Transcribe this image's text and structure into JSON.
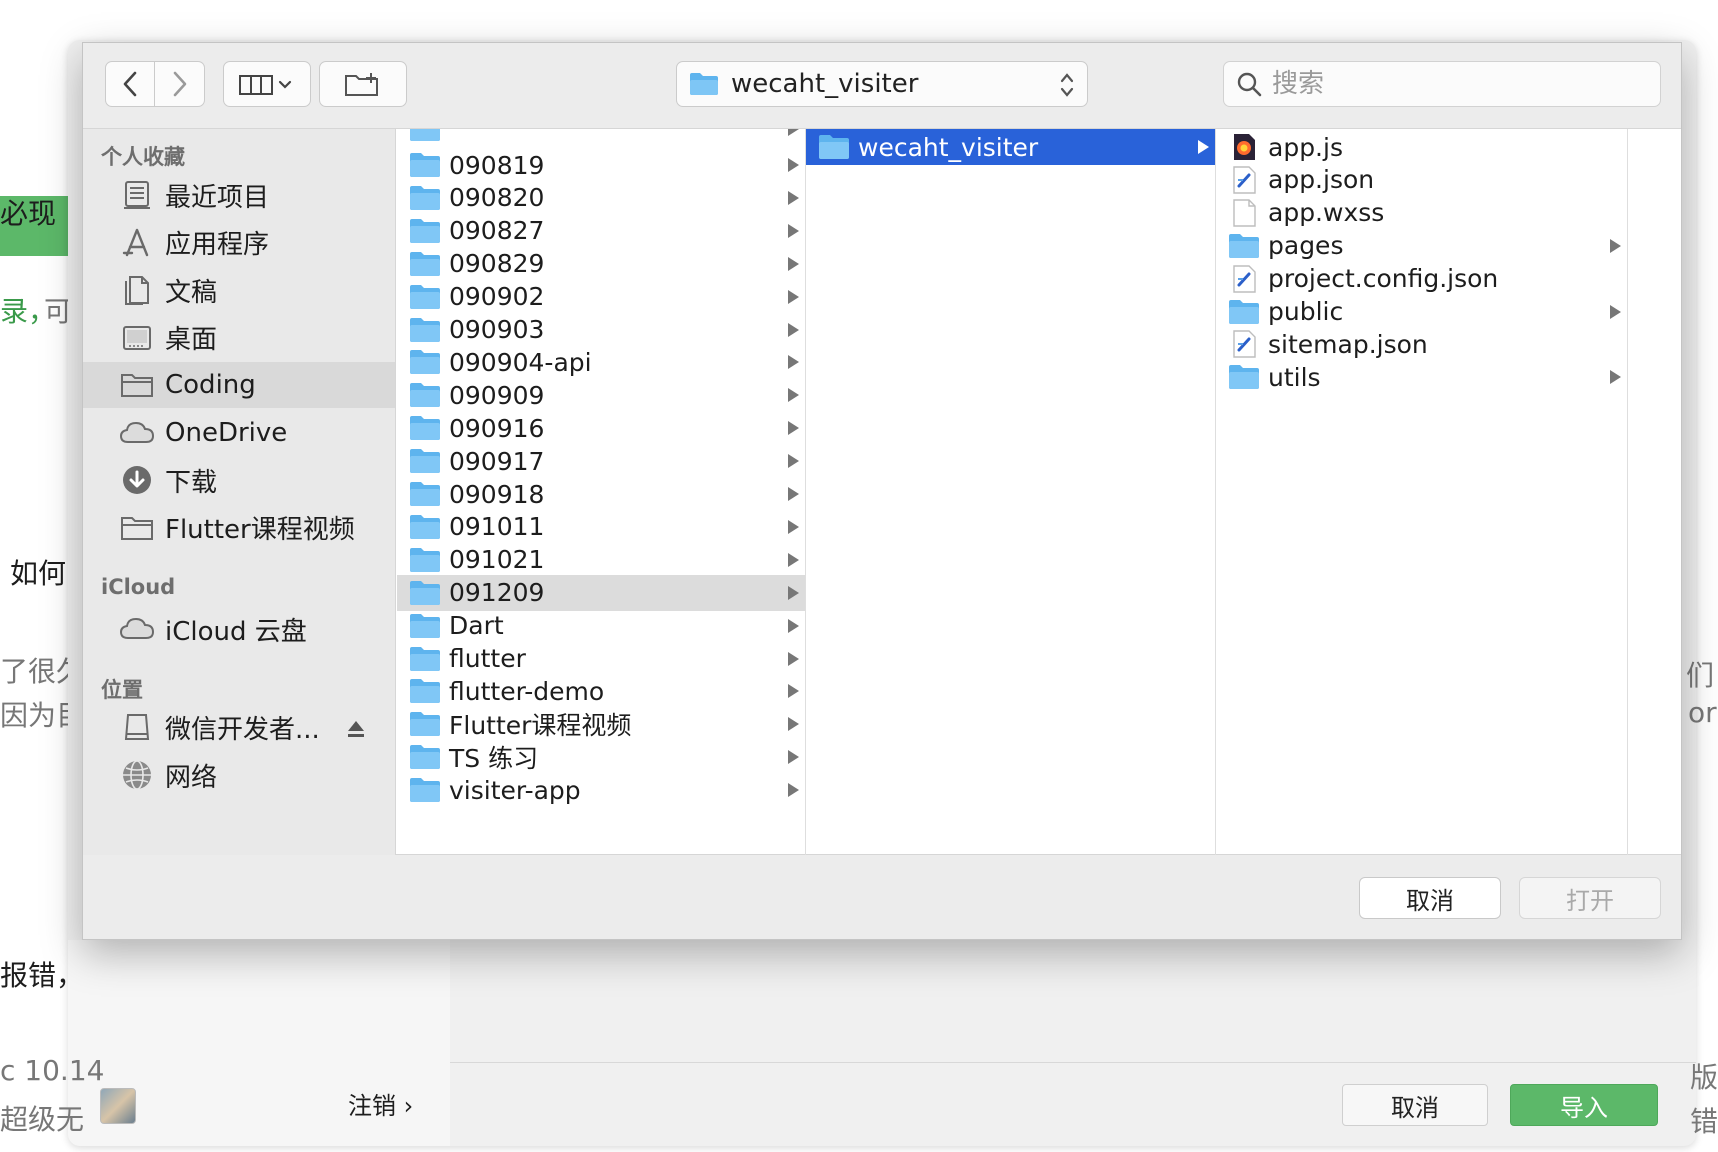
{
  "background": {
    "fragments": [
      "必现",
      "录，",
      "可",
      "如何",
      "了很久",
      "因为目",
      "报错，",
      "c 10.14",
      "超级无",
      "们",
      "or",
      "版",
      "错"
    ],
    "accent_color": "#5cb869",
    "logout_label": "注销",
    "logout_chevron": "›",
    "cancel_label": "取消",
    "import_label": "导入"
  },
  "dialog": {
    "toolbar": {
      "back_icon": "chevron-left-icon",
      "forward_icon": "chevron-right-icon",
      "view_icon": "column-view-icon",
      "new_folder_icon": "new-folder-icon",
      "path_label": "wecaht_visiter",
      "search_placeholder": "搜索"
    },
    "sidebar": {
      "sections": [
        {
          "title": "个人收藏"
        },
        {
          "title": "iCloud"
        },
        {
          "title": "位置"
        }
      ],
      "favorites": [
        {
          "label": "最近项目",
          "icon": "recents-icon"
        },
        {
          "label": "应用程序",
          "icon": "applications-icon"
        },
        {
          "label": "文稿",
          "icon": "documents-icon"
        },
        {
          "label": "桌面",
          "icon": "desktop-icon"
        },
        {
          "label": "Coding",
          "icon": "folder-icon",
          "selected": true
        },
        {
          "label": "OneDrive",
          "icon": "cloud-icon"
        },
        {
          "label": "下载",
          "icon": "download-icon"
        },
        {
          "label": "Flutter课程视频",
          "icon": "folder-icon"
        }
      ],
      "icloud": [
        {
          "label": "iCloud 云盘",
          "icon": "cloud-icon"
        }
      ],
      "locations": [
        {
          "label": "微信开发者...",
          "icon": "disk-icon",
          "eject": true
        },
        {
          "label": "网络",
          "icon": "network-icon"
        }
      ]
    },
    "column1": [
      {
        "name": "090819"
      },
      {
        "name": "090820"
      },
      {
        "name": "090827"
      },
      {
        "name": "090829"
      },
      {
        "name": "090902"
      },
      {
        "name": "090903"
      },
      {
        "name": "090904-api"
      },
      {
        "name": "090909"
      },
      {
        "name": "090916"
      },
      {
        "name": "090917"
      },
      {
        "name": "090918"
      },
      {
        "name": "091011"
      },
      {
        "name": "091021"
      },
      {
        "name": "091209",
        "highlighted": true
      },
      {
        "name": "Dart"
      },
      {
        "name": "flutter"
      },
      {
        "name": "flutter-demo"
      },
      {
        "name": "Flutter课程视频"
      },
      {
        "name": "TS 练习"
      },
      {
        "name": "visiter-app"
      }
    ],
    "column2": [
      {
        "name": "wecaht_visiter",
        "selected": true
      }
    ],
    "column3": [
      {
        "name": "app.js",
        "kind": "js",
        "folder": false
      },
      {
        "name": "app.json",
        "kind": "json",
        "folder": false
      },
      {
        "name": "app.wxss",
        "kind": "blank",
        "folder": false
      },
      {
        "name": "pages",
        "kind": "folder",
        "folder": true
      },
      {
        "name": "project.config.json",
        "kind": "json",
        "folder": false
      },
      {
        "name": "public",
        "kind": "folder",
        "folder": true
      },
      {
        "name": "sitemap.json",
        "kind": "json",
        "folder": false
      },
      {
        "name": "utils",
        "kind": "folder",
        "folder": true
      }
    ],
    "footer": {
      "cancel_label": "取消",
      "open_label": "打开"
    },
    "colors": {
      "selection": "#2962d9",
      "folder": "#5eb4ee"
    }
  }
}
